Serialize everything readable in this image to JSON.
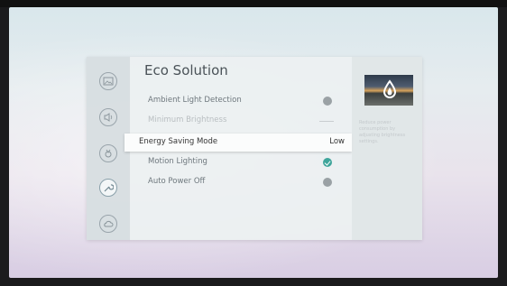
{
  "menu": {
    "title": "Eco Solution",
    "items": [
      {
        "label": "Ambient Light Detection",
        "state": "off"
      },
      {
        "label": "Minimum Brightness",
        "state": "dim"
      },
      {
        "label": "Energy Saving Mode",
        "value": "Low",
        "state": "selected"
      },
      {
        "label": "Motion Lighting",
        "state": "on"
      },
      {
        "label": "Auto Power Off",
        "state": "off"
      }
    ]
  },
  "categories": [
    {
      "name": "picture",
      "icon": "picture-icon"
    },
    {
      "name": "sound",
      "icon": "speaker-icon"
    },
    {
      "name": "broadcasting",
      "icon": "broadcast-icon"
    },
    {
      "name": "general",
      "icon": "wrench-icon",
      "active": true
    },
    {
      "name": "support",
      "icon": "cloud-icon"
    }
  ],
  "info": {
    "description": "Reduce power consumption by adjusting brightness settings.",
    "thumbnail_icon": "water-drop-icon"
  },
  "colors": {
    "toggle_on": "#3fa59b",
    "toggle_off": "#9aa1a5"
  }
}
